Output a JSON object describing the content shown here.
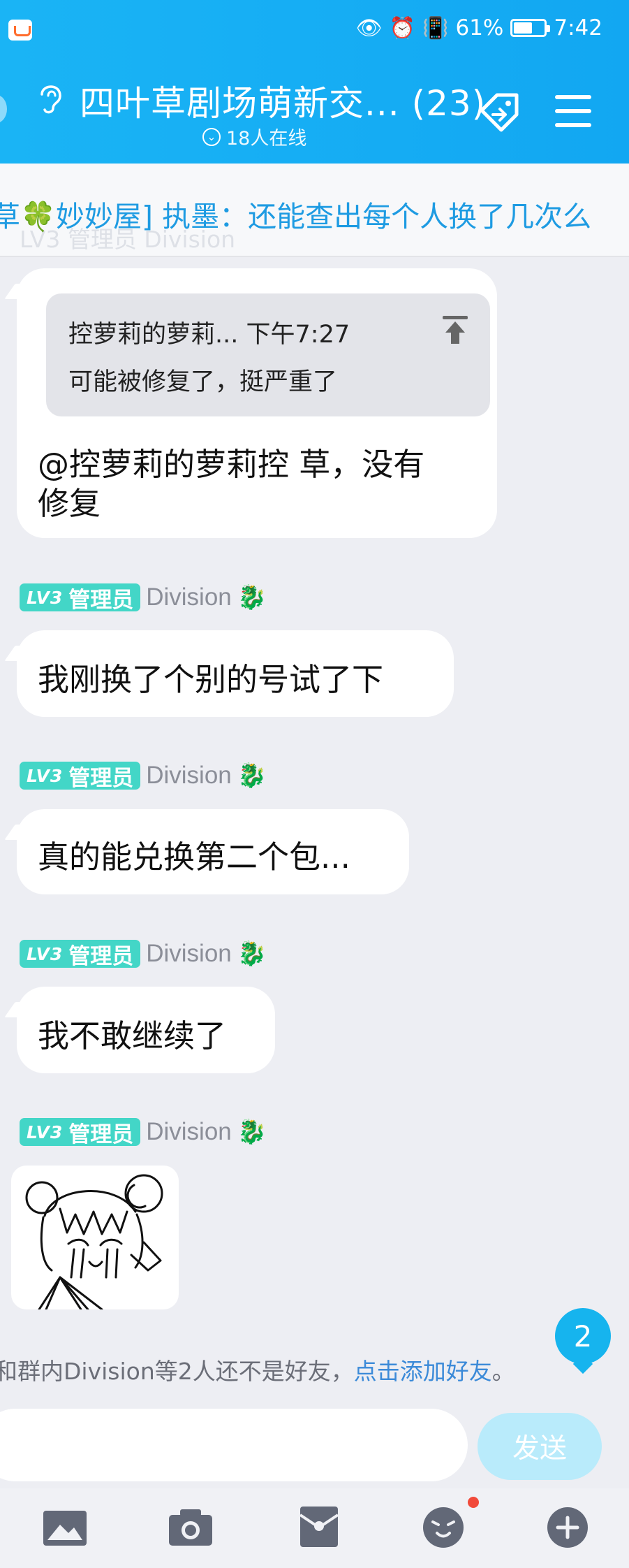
{
  "status_bar": {
    "battery_percent": "61%",
    "time": "7:42",
    "battery_level": 0.61
  },
  "header": {
    "title": "四叶草剧场萌新交... (23)",
    "online": "18人在线"
  },
  "notice": {
    "text": "草🍀妙妙屋] 执墨：还能查出每个人换了几次么",
    "ghost": "LV3 管理员 Division"
  },
  "messages": [
    {
      "quote": {
        "author": "控萝莉的萝莉...",
        "time": "下午7:27",
        "text": "可能被修复了，挺严重了"
      },
      "line1": "@控萝莉的萝莉控 草，没有",
      "line2": "修复"
    },
    {
      "sender": {
        "level": "LV3",
        "role": "管理员",
        "name": "Division"
      },
      "text": "我刚换了个别的号试了下"
    },
    {
      "sender": {
        "level": "LV3",
        "role": "管理员",
        "name": "Division"
      },
      "text": "真的能兑换第二个包..."
    },
    {
      "sender": {
        "level": "LV3",
        "role": "管理员",
        "name": "Division"
      },
      "text": "我不敢继续了"
    },
    {
      "sender": {
        "level": "LV3",
        "role": "管理员",
        "name": "Division"
      },
      "sticker": "crying-girl-sticker"
    }
  ],
  "friend_tip": {
    "text": "和群内Division等2人还不是好友，",
    "link": "点击添加好友",
    "end": "。"
  },
  "unread_count": "2",
  "input": {
    "placeholder": "",
    "send_label": "发送"
  },
  "toolbar": [
    "image-icon",
    "camera-icon",
    "red-packet-icon",
    "emoji-icon",
    "plus-icon"
  ],
  "colors": {
    "header": "#12a7f2",
    "badge": "#43d6c7",
    "link": "#3b8ad8",
    "send_disabled": "#b9ebfb"
  }
}
